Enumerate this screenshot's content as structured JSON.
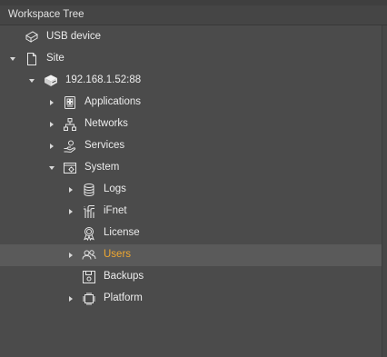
{
  "header": {
    "title": "Workspace Tree"
  },
  "tree": {
    "usb": {
      "label": "USB device",
      "icon": "usb-drive-icon"
    },
    "site": {
      "label": "Site",
      "icon": "document-icon"
    },
    "device": {
      "label": "192.168.1.52:88",
      "icon": "server-device-icon"
    },
    "applications": {
      "label": "Applications",
      "icon": "app-grid-icon"
    },
    "networks": {
      "label": "Networks",
      "icon": "network-icon"
    },
    "services": {
      "label": "Services",
      "icon": "services-hand-icon"
    },
    "system": {
      "label": "System",
      "icon": "system-settings-icon"
    },
    "logs": {
      "label": "Logs",
      "icon": "database-icon"
    },
    "ifnet": {
      "label": "iFnet",
      "icon": "ifnet-icon"
    },
    "license": {
      "label": "License",
      "icon": "license-badge-icon"
    },
    "users": {
      "label": "Users",
      "icon": "users-icon",
      "selected": true
    },
    "backups": {
      "label": "Backups",
      "icon": "floppy-disk-icon"
    },
    "platform": {
      "label": "Platform",
      "icon": "chip-icon"
    }
  },
  "colors": {
    "selected_text": "#f0a830",
    "text": "#ececec",
    "background": "#4b4b4b"
  }
}
